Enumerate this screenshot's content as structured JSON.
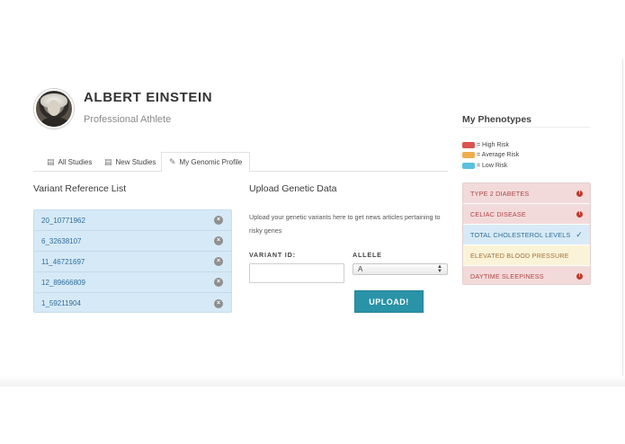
{
  "profile": {
    "name": "ALBERT EINSTEIN",
    "occupation": "Professional Athlete"
  },
  "tabs": [
    {
      "label": "All Studies",
      "icon": "book-icon",
      "active": false
    },
    {
      "label": "New Studies",
      "icon": "book-icon",
      "active": false
    },
    {
      "label": "My Genomic Profile",
      "icon": "pencil-icon",
      "active": true
    }
  ],
  "variants": {
    "title": "Variant Reference List",
    "items": [
      "20_10771962",
      "6_32638107",
      "11_46721697",
      "12_89666809",
      "1_59211904"
    ]
  },
  "upload": {
    "title": "Upload Genetic Data",
    "description": "Upload your genetic variants here to get news articles pertaining to risky genes",
    "variant_label": "VARIANT ID:",
    "variant_value": "",
    "allele_label": "ALLELE",
    "allele_selected": "A",
    "button_label": "UPLOAD!"
  },
  "phenotypes": {
    "title": "My Phenotypes",
    "legend": [
      {
        "label": "= High Risk",
        "color": "#d9534f"
      },
      {
        "label": "= Average Risk",
        "color": "#f0ad4e"
      },
      {
        "label": "= Low Risk",
        "color": "#5bc0de"
      }
    ],
    "items": [
      {
        "label": "TYPE 2 DIABETES",
        "risk": "high",
        "icon": "alert-icon"
      },
      {
        "label": "CELIAC DISEASE",
        "risk": "high",
        "icon": "alert-icon"
      },
      {
        "label": "TOTAL CHOLESTEROL LEVELS",
        "risk": "low",
        "icon": "check-icon"
      },
      {
        "label": "ELEVATED BLOOD PRESSURE",
        "risk": "average",
        "icon": ""
      },
      {
        "label": "DAYTIME SLEEPINESS",
        "risk": "high",
        "icon": "alert-icon"
      }
    ]
  }
}
